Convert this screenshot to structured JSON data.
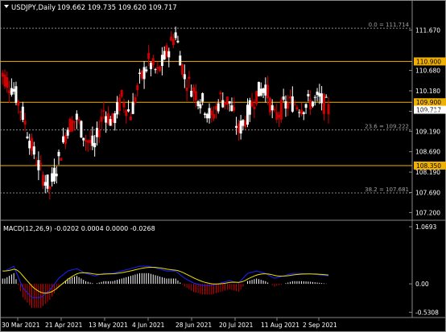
{
  "header": {
    "symbol_label": "USDJPY,Daily",
    "ohlc": "109.662 109.735 109.620 109.717"
  },
  "main_price_scale": [
    "111.670",
    "110.680",
    "110.180",
    "109.680",
    "109.190",
    "108.690",
    "108.190",
    "107.690",
    "107.200"
  ],
  "main_price_range": [
    107.05,
    112.05
  ],
  "horizontal_levels": [
    {
      "price": 110.9,
      "label": "110.900",
      "color": "#f0b000"
    },
    {
      "price": 109.9,
      "label": "109.900",
      "color": "#f0b000"
    },
    {
      "price": 108.35,
      "label": "108.350",
      "color": "#f0b000"
    }
  ],
  "current_price": {
    "price": 109.717,
    "label": "109.717"
  },
  "fibonacci": [
    {
      "price": 111.714,
      "label": "0.0 = 111.714"
    },
    {
      "price": 109.222,
      "label": "23.6 = 109.222"
    },
    {
      "price": 107.681,
      "label": "38.2 = 107.681"
    }
  ],
  "macd": {
    "label": "MACD(12,26,9) -0.0202 0.0004 0.0000 -0.0268",
    "scale": [
      "1.0693",
      "0.00",
      "-0.5308"
    ],
    "range": [
      -0.6,
      1.1
    ]
  },
  "time_axis": [
    "30 Mar 2021",
    "21 Apr 2021",
    "13 May 2021",
    "4 Jun 2021",
    "28 Jun 2021",
    "20 Jul 2021",
    "11 Aug 2021",
    "2 Sep 2021"
  ],
  "colors": {
    "bull": "#ffffff",
    "bear": "#d00000",
    "macd_line": "#2020ff",
    "signal_line": "#e8e000",
    "grid": "#888888",
    "level": "#f0b000"
  },
  "chart_data": {
    "type": "candlestick",
    "title": "USDJPY,Daily",
    "x": [
      "30 Mar 2021",
      "21 Apr 2021",
      "13 May 2021",
      "4 Jun 2021",
      "28 Jun 2021",
      "20 Jul 2021",
      "11 Aug 2021",
      "2 Sep 2021"
    ],
    "close": [
      110.5,
      110.2,
      109.6,
      108.8,
      108.2,
      107.8,
      108.5,
      109.3,
      109.5,
      109.0,
      108.8,
      109.7,
      109.4,
      110.0,
      109.6,
      110.4,
      110.9,
      110.6,
      111.1,
      111.6,
      110.5,
      110.2,
      109.9,
      109.5,
      110.0,
      109.9,
      109.2,
      109.6,
      110.1,
      110.3,
      109.5,
      109.8,
      109.9,
      109.8,
      109.9,
      110.0,
      109.717
    ],
    "macd_histogram": [
      0.1,
      0.2,
      -0.25,
      -0.45,
      -0.45,
      -0.3,
      -0.05,
      0.1,
      0.15,
      0.05,
      0.0,
      0.05,
      0.05,
      0.1,
      0.15,
      0.2,
      0.2,
      0.15,
      0.1,
      0.1,
      -0.05,
      -0.15,
      -0.2,
      -0.2,
      -0.15,
      -0.1,
      -0.15,
      0.05,
      0.1,
      0.05,
      -0.05,
      0.0,
      0.05,
      0.05,
      0.04,
      0.02,
      0.0
    ]
  }
}
